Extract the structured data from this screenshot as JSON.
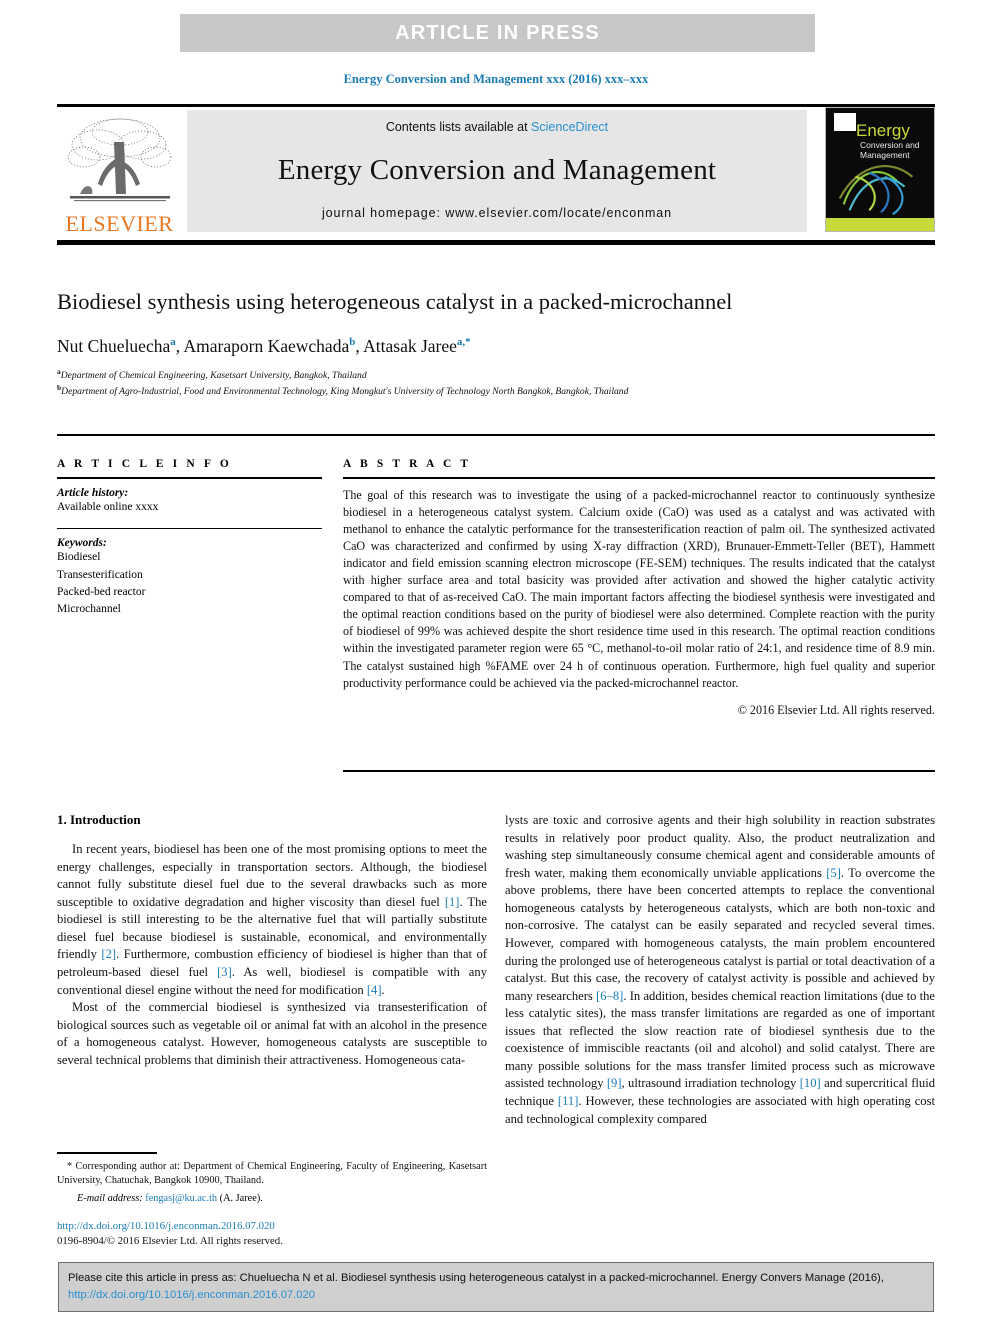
{
  "banner": {
    "label": "ARTICLE  IN  PRESS"
  },
  "journal_ref": "Energy Conversion and Management xxx (2016) xxx–xxx",
  "masthead": {
    "contents_prefix": "Contents lists available at ",
    "sciencedirect": "ScienceDirect",
    "journal_title": "Energy Conversion and Management",
    "homepage": "journal homepage: www.elsevier.com/locate/enconman",
    "publisher": "ELSEVIER",
    "cover_title": "Energy",
    "cover_subtitle": "Conversion\nand Management"
  },
  "article": {
    "title": "Biodiesel synthesis using heterogeneous catalyst in a packed-microchannel",
    "authors": "Nut Chueluecha ",
    "author1": "Nut Chueluecha",
    "author1_mark": "a",
    "author2": "Amaraporn Kaewchada",
    "author2_mark": "b",
    "author3": "Attasak Jaree",
    "author3_mark": "a,*",
    "affiliation_a_mark": "a",
    "affiliation_a": "Department of Chemical Engineering, Kasetsart University, Bangkok, Thailand",
    "affiliation_b_mark": "b",
    "affiliation_b": "Department of Agro-Industrial, Food and Environmental Technology, King Mongkut's University of Technology North Bangkok, Bangkok, Thailand"
  },
  "article_info": {
    "heading": "A R T I C L E   I N F O",
    "history_label": "Article history:",
    "history_value": "Available online xxxx",
    "keywords_label": "Keywords:",
    "keywords": [
      "Biodiesel",
      "Transesterification",
      "Packed-bed reactor",
      "Microchannel"
    ]
  },
  "abstract": {
    "heading": "A B S T R A C T",
    "body": "The goal of this research was to investigate the using of a packed-microchannel reactor to continuously synthesize biodiesel in a heterogeneous catalyst system. Calcium oxide (CaO) was used as a catalyst and was activated with methanol to enhance the catalytic performance for the transesterification reaction of palm oil. The synthesized activated CaO was characterized and confirmed by using X-ray diffraction (XRD), Brunauer-Emmett-Teller (BET), Hammett indicator and field emission scanning electron microscope (FE-SEM) techniques. The results indicated that the catalyst with higher surface area and total basicity was provided after activation and showed the higher catalytic activity compared to that of as-received CaO. The main important factors affecting the biodiesel synthesis were investigated and the optimal reaction conditions based on the purity of biodiesel were also determined. Complete reaction with the purity of biodiesel of 99% was achieved despite the short residence time used in this research. The optimal reaction conditions within the investigated parameter region were 65 °C, methanol-to-oil molar ratio of 24:1, and residence time of 8.9 min. The catalyst sustained high %FAME over 24 h of continuous operation. Furthermore, high fuel quality and superior productivity performance could be achieved via the packed-microchannel reactor.",
    "copyright": "© 2016 Elsevier Ltd. All rights reserved."
  },
  "body": {
    "section_heading": "1. Introduction",
    "left_para1_a": "In recent years, biodiesel has been one of the most promising options to meet the energy challenges, especially in transportation sectors. Although, the biodiesel cannot fully substitute diesel fuel due to the several drawbacks such as more susceptible to oxidative degradation and higher viscosity than diesel fuel ",
    "left_ref1": "[1]",
    "left_para1_b": ". The biodiesel is still interesting to be the alternative fuel that will partially substitute diesel fuel because biodiesel is sustainable, economical, and environmentally friendly ",
    "left_ref2": "[2]",
    "left_para1_c": ". Furthermore, combustion efficiency of biodiesel is higher than that of petroleum-based diesel fuel ",
    "left_ref3": "[3]",
    "left_para1_d": ". As well, biodiesel is compatible with any conventional diesel engine without the need for modification ",
    "left_ref4": "[4]",
    "left_para1_e": ".",
    "left_para2": "Most of the commercial biodiesel is synthesized via transesterification of biological sources such as vegetable oil or animal fat with an alcohol in the presence of a homogeneous catalyst. However, homogeneous catalysts are susceptible to several technical problems that diminish their attractiveness. Homogeneous cata-",
    "right_para_a": "lysts are toxic and corrosive agents and their high solubility in reaction substrates results in relatively poor product quality. Also, the product neutralization and washing step simultaneously consume chemical agent and considerable amounts of fresh water, making them economically unviable applications ",
    "right_ref5": "[5]",
    "right_para_b": ". To overcome the above problems, there have been concerted attempts to replace the conventional homogeneous catalysts by heterogeneous catalysts, which are both non-toxic and non-corrosive. The catalyst can be easily separated and recycled several times. However, compared with homogeneous catalysts, the main problem encountered during the prolonged use of heterogeneous catalyst is partial or total deactivation of a catalyst. But this case, the recovery of catalyst activity is possible and achieved by many researchers ",
    "right_ref68": "[6–8]",
    "right_para_c": ". In addition, besides chemical reaction limitations (due to the less catalytic sites), the mass transfer limitations are regarded as one of important issues that reflected the slow reaction rate of biodiesel synthesis due to the coexistence of immiscible reactants (oil and alcohol) and solid catalyst. There are many possible solutions for the mass transfer limited process such as microwave assisted technology ",
    "right_ref9": "[9]",
    "right_para_d": ", ultrasound irradiation technology ",
    "right_ref10": "[10]",
    "right_para_e": " and supercritical fluid technique ",
    "right_ref11": "[11]",
    "right_para_f": ". However, these technologies are associated with high operating cost and technological complexity compared"
  },
  "footnote": {
    "star": "*",
    "corresponding": " Corresponding author at: Department of Chemical Engineering, Faculty of Engineering, Kasetsart University, Chatuchak, Bangkok 10900, Thailand.",
    "email_label": "E-mail address:",
    "email": "fengasj@ku.ac.th",
    "email_suffix": " (A. Jaree)."
  },
  "doi": {
    "url": "http://dx.doi.org/10.1016/j.enconman.2016.07.020",
    "issn": "0196-8904/© 2016 Elsevier Ltd. All rights reserved."
  },
  "cite_box": {
    "text_a": "Please cite this article in press as: Chueluecha N et al. Biodiesel synthesis using heterogeneous catalyst in a packed-microchannel. Energy Convers Manage (2016), ",
    "link": "http://dx.doi.org/10.1016/j.enconman.2016.07.020"
  },
  "colors": {
    "link": "#1b7cb5",
    "banner_bg": "#c6c7c9",
    "masthead_bg": "#e6e6e6",
    "elsevier_orange": "#e87722",
    "cite_bg": "#cfcfcf"
  }
}
